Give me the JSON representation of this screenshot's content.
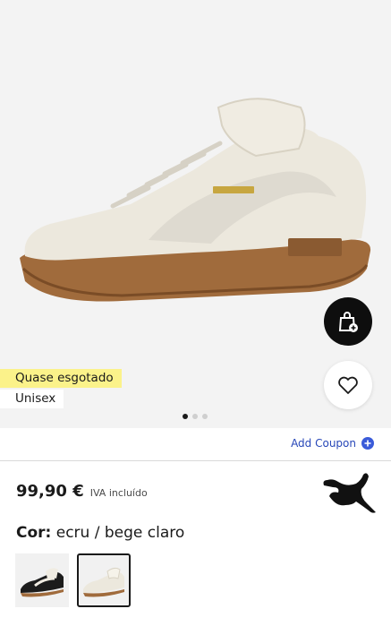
{
  "product": {
    "image_alt": "white leather sneaker with gum sole",
    "badges": [
      "Quase esgotado",
      "Unisex"
    ],
    "gallery_dots": 3,
    "gallery_active": 0
  },
  "actions": {
    "add_to_bag_icon": "bag-plus-icon",
    "wishlist_icon": "heart-icon"
  },
  "coupon": {
    "label": "Add Coupon",
    "icon": "plus-icon"
  },
  "price": {
    "amount": "99,90 €",
    "tax_note": "IVA incluído"
  },
  "brand": {
    "logo": "puma-logo"
  },
  "color": {
    "label": "Cor:",
    "value": "ecru / bege claro"
  },
  "variants": [
    {
      "name": "black",
      "selected": false
    },
    {
      "name": "ecru",
      "selected": true
    }
  ],
  "colors": {
    "badge_yellow": "#fbf28a",
    "accent": "#2747b8",
    "dark": "#0e0e0e"
  }
}
